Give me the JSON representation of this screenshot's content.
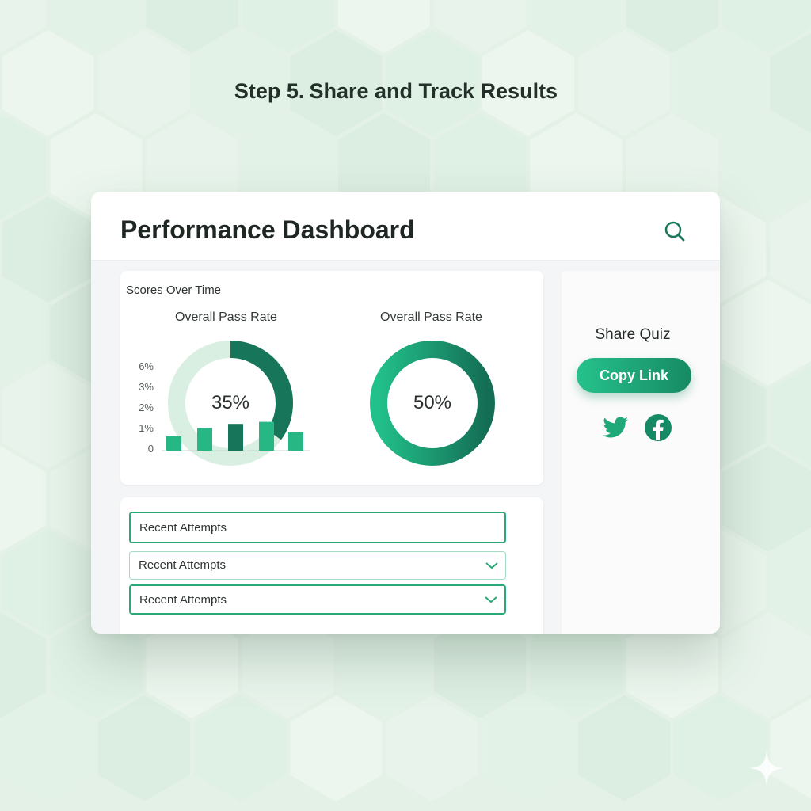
{
  "heading": {
    "step": "Step 5.",
    "title": "Share and Track Results"
  },
  "dashboard": {
    "title": "Performance Dashboard"
  },
  "scores_card": {
    "label": "Scores Over Time",
    "y_ticks": [
      "6%",
      "3%",
      "2%",
      "1%",
      "0"
    ]
  },
  "chart_data": [
    {
      "type": "bar",
      "title": "Overall Pass Rate",
      "categories": [
        "",
        "",
        "",
        "",
        ""
      ],
      "values": [
        0.7,
        1.1,
        1.3,
        1.4,
        0.9
      ],
      "y_ticks": [
        "0",
        "1%",
        "2%",
        "3%",
        "6%"
      ]
    },
    {
      "type": "pie",
      "title": "Overall Pass Rate",
      "center_label": "35%",
      "values": [
        35,
        65
      ]
    },
    {
      "type": "pie",
      "title": "Overall Pass Rate",
      "center_label": "50%",
      "values": [
        100
      ]
    }
  ],
  "recent": {
    "items": [
      {
        "label": "Recent Attempts"
      },
      {
        "label": "Recent Attempts"
      },
      {
        "label": "Recent Attempts"
      }
    ]
  },
  "share": {
    "title": "Share Quiz",
    "copy_label": "Copy Link",
    "icons": [
      "twitter-icon",
      "facebook-icon"
    ]
  },
  "colors": {
    "accent": "#1fb985",
    "accent_dark": "#177559",
    "accent_light": "#d9efe1",
    "background": "#e4f1e7"
  }
}
